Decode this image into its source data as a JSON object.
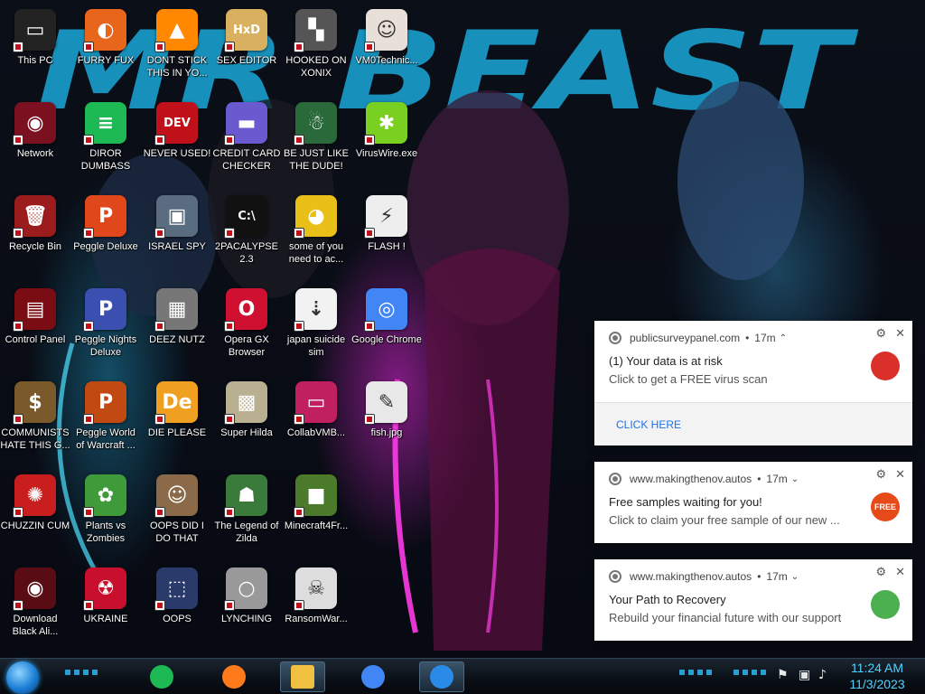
{
  "desktop": {
    "icons": [
      {
        "label": "This PC",
        "icon": "computer-icon",
        "color": "#222222",
        "glyph": "▭"
      },
      {
        "label": "Network",
        "icon": "network-icon",
        "color": "#7a1020",
        "glyph": "◉"
      },
      {
        "label": "Recycle Bin",
        "icon": "recycle-bin-icon",
        "color": "#9a1c1c",
        "glyph": "🗑"
      },
      {
        "label": "Control Panel",
        "icon": "control-panel-icon",
        "color": "#7a0d14",
        "glyph": "▤"
      },
      {
        "label": "COMMUNISTS HATE THIS G...",
        "icon": "money-bag-icon",
        "color": "#7a5a2a",
        "glyph": "$"
      },
      {
        "label": "CHUZZIN CUM",
        "icon": "chuzzle-icon",
        "color": "#c81e1e",
        "glyph": "✺"
      },
      {
        "label": "Download Black Ali...",
        "icon": "black-orb-icon",
        "color": "#5a0c14",
        "glyph": "◉"
      },
      {
        "label": "FURRY FUX",
        "icon": "firefox-icon",
        "color": "#e8661c",
        "glyph": "◐"
      },
      {
        "label": "DIROR DUMBASS",
        "icon": "spotify-like-icon",
        "color": "#1db954",
        "glyph": "≡"
      },
      {
        "label": "Peggle Deluxe",
        "icon": "peggle-icon",
        "color": "#e0471a",
        "glyph": "P"
      },
      {
        "label": "Peggle Nights Deluxe",
        "icon": "peggle-nights-icon",
        "color": "#3a4fb0",
        "glyph": "P"
      },
      {
        "label": "Peggle World of Warcraft ...",
        "icon": "peggle-wow-icon",
        "color": "#c04a12",
        "glyph": "P"
      },
      {
        "label": "Plants vs Zombies",
        "icon": "flower-icon",
        "color": "#3f9a3a",
        "glyph": "✿"
      },
      {
        "label": "UKRAINE",
        "icon": "radiation-icon",
        "color": "#c8102e",
        "glyph": "☢"
      },
      {
        "label": "DONT STICK THIS IN YO...",
        "icon": "vlc-cone-icon",
        "color": "#ff8800",
        "glyph": "▲"
      },
      {
        "label": "NEVER USED!",
        "icon": "devcpp-icon",
        "color": "#c0101a",
        "glyph": "DEV"
      },
      {
        "label": "ISRAEL SPY",
        "icon": "network-pc-icon",
        "color": "#5a6c80",
        "glyph": "▣"
      },
      {
        "label": "DEEZ NUTZ",
        "icon": "windows-stack-icon",
        "color": "#777777",
        "glyph": "▦"
      },
      {
        "label": "DIE PLEASE",
        "icon": "adobe-de-icon",
        "color": "#f0a020",
        "glyph": "De"
      },
      {
        "label": "OOPS DID I DO THAT",
        "icon": "portrait-icon",
        "color": "#8a6a48",
        "glyph": "☺"
      },
      {
        "label": "OOPS",
        "icon": "oops-app-icon",
        "color": "#2a3a6a",
        "glyph": "⬚"
      },
      {
        "label": "SEX EDITOR",
        "icon": "hxd-editor-icon",
        "color": "#d8b060",
        "glyph": "HxD"
      },
      {
        "label": "CREDIT CARD CHECKER",
        "icon": "credit-card-icon",
        "color": "#6a5ad0",
        "glyph": "▬"
      },
      {
        "label": "2PACALYPSE 2.3",
        "icon": "terminal-icon",
        "color": "#111111",
        "glyph": "C:\\"
      },
      {
        "label": "Opera GX Browser",
        "icon": "opera-gx-icon",
        "color": "#d01030",
        "glyph": "O"
      },
      {
        "label": "Super Hilda",
        "icon": "pixel-game-icon",
        "color": "#b8b090",
        "glyph": "▩"
      },
      {
        "label": "The Legend of Zilda",
        "icon": "pixel-hero-icon",
        "color": "#3a7a3a",
        "glyph": "☗"
      },
      {
        "label": "LYNCHING",
        "icon": "noose-icon",
        "color": "#999999",
        "glyph": "○"
      },
      {
        "label": "HOOKED ON XONIX",
        "icon": "xonix-icon",
        "color": "#555555",
        "glyph": "▚"
      },
      {
        "label": "BE JUST LIKE THE DUDE!",
        "icon": "santa-icon",
        "color": "#2a6a3a",
        "glyph": "☃"
      },
      {
        "label": "some of you need to ac...",
        "icon": "beaver-icon",
        "color": "#e8c018",
        "glyph": "◕"
      },
      {
        "label": "japan suicide sim",
        "icon": "document-icon",
        "color": "#f2f2f2",
        "glyph": "⇣"
      },
      {
        "label": "CollabVMB...",
        "icon": "monitor-icon",
        "color": "#c02060",
        "glyph": "▭"
      },
      {
        "label": "Minecraft4Fr...",
        "icon": "minecraft-block-icon",
        "color": "#4a7a2a",
        "glyph": "■"
      },
      {
        "label": "RansomWar...",
        "icon": "skull-icon",
        "color": "#dddddd",
        "glyph": "☠"
      },
      {
        "label": "VM0Technic...",
        "icon": "doctor-icon",
        "color": "#e8e0d8",
        "glyph": "☺"
      },
      {
        "label": "VirusWire.exe",
        "icon": "lime-icon",
        "color": "#7ad020",
        "glyph": "✱"
      },
      {
        "label": "FLASH !",
        "icon": "flash-doc-icon",
        "color": "#eeeeee",
        "glyph": "⚡"
      },
      {
        "label": "Google Chrome",
        "icon": "chrome-icon",
        "color": "#4285f4",
        "glyph": "◎"
      },
      {
        "label": "fish.jpg",
        "icon": "image-file-icon",
        "color": "#e8e8e8",
        "glyph": "✎"
      }
    ]
  },
  "wallpaper": {
    "banner": "MR BEAST"
  },
  "notifications": [
    {
      "source": "publicsurveypanel.com",
      "age": "17m",
      "chevron": "⌃",
      "title": "(1) Your data is at risk",
      "body": "Click to get a FREE virus scan",
      "action": "CLICK HERE",
      "pic_icon": "shield-lock-icon",
      "pic_color": "#d9302a",
      "pic_text": ""
    },
    {
      "source": "www.makingthenov.autos",
      "age": "17m",
      "chevron": "⌄",
      "title": "Free samples waiting for you!",
      "body": "Click to claim your free sample of our new ...",
      "pic_icon": "free-badge-icon",
      "pic_color": "#e64a19",
      "pic_text": "FREE"
    },
    {
      "source": "www.makingthenov.autos",
      "age": "17m",
      "chevron": "⌄",
      "title": "Your Path to Recovery",
      "body": "Rebuild your financial future with our support",
      "pic_icon": "growth-chart-icon",
      "pic_color": "#4caf50",
      "pic_text": ""
    }
  ],
  "taskbar": {
    "apps": [
      {
        "name": "spotify-like-app",
        "icon": "green-app-icon",
        "color": "#1db954"
      },
      {
        "name": "firefox",
        "icon": "firefox-icon",
        "color": "#ff7a1a"
      },
      {
        "name": "file-explorer",
        "icon": "folder-icon",
        "color": "#f0c040"
      },
      {
        "name": "chrome",
        "icon": "chrome-icon",
        "color": "#4285f4"
      },
      {
        "name": "internet-explorer",
        "icon": "ie-icon",
        "color": "#2a8ae8"
      }
    ],
    "clock": {
      "time": "11:24 AM",
      "date": "11/3/2023"
    }
  }
}
